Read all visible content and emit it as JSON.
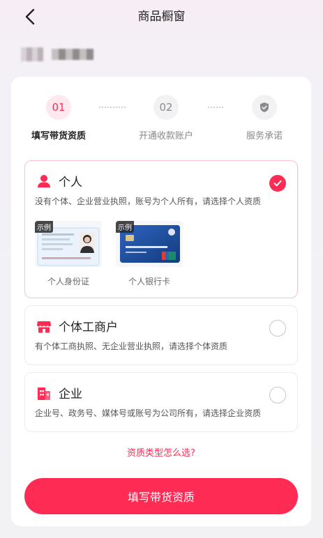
{
  "header": {
    "title": "商品橱窗"
  },
  "steps": [
    {
      "num": "01",
      "label": "填写带货资质"
    },
    {
      "num": "02",
      "label": "开通收款账户"
    },
    {
      "num": "",
      "label": "服务承诺"
    }
  ],
  "options": [
    {
      "title": "个人",
      "desc": "没有个体、企业营业执照，账号为个人所有，请选择个人资质",
      "selected": true,
      "samples": [
        {
          "tag": "示例",
          "caption": "个人身份证"
        },
        {
          "tag": "示例",
          "caption": "个人银行卡"
        }
      ]
    },
    {
      "title": "个体工商户",
      "desc": "有个体工商执照、无企业营业执照，请选择个体资质",
      "selected": false
    },
    {
      "title": "企业",
      "desc": "企业号、政务号、媒体号或账号为公司所有，请选择企业资质",
      "selected": false
    }
  ],
  "help_link": "资质类型怎么选?",
  "submit_label": "填写带货资质",
  "colors": {
    "accent": "#fe2c55",
    "accent_light": "#ffe9ee"
  },
  "icons": [
    "back-arrow-icon",
    "shield-check-icon",
    "person-icon",
    "shop-icon",
    "building-icon",
    "check-icon"
  ]
}
